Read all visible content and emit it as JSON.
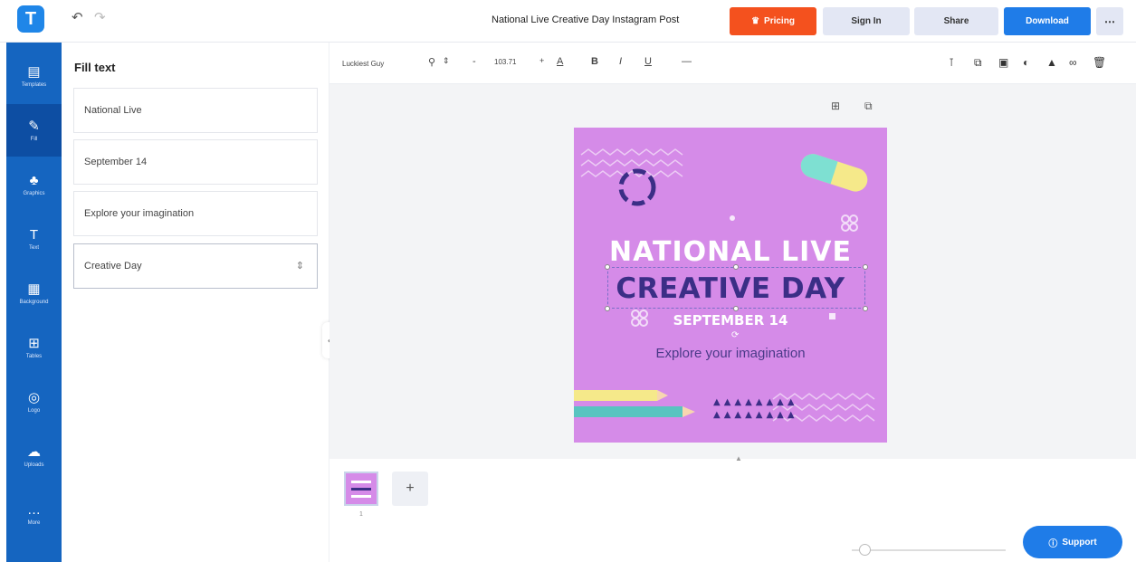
{
  "header": {
    "logo": "T",
    "doc_title": "National Live Creative Day Instagram Post",
    "pricing_label": "Pricing",
    "signin_label": "Sign In",
    "share_label": "Share",
    "download_label": "Download",
    "more_label": "⋯"
  },
  "sidebar": {
    "items": [
      {
        "label": "Templates",
        "icon": "template-icon",
        "glyph": "▤"
      },
      {
        "label": "Fill",
        "icon": "pen-icon",
        "glyph": "✎"
      },
      {
        "label": "Graphics",
        "icon": "shapes-icon",
        "glyph": "♣"
      },
      {
        "label": "Text",
        "icon": "text-icon",
        "glyph": "T"
      },
      {
        "label": "Background",
        "icon": "background-icon",
        "glyph": "▦"
      },
      {
        "label": "Tables",
        "icon": "table-icon",
        "glyph": "⊞"
      },
      {
        "label": "Logo",
        "icon": "logo-icon",
        "glyph": "◎"
      },
      {
        "label": "Uploads",
        "icon": "upload-icon",
        "glyph": "☁"
      },
      {
        "label": "More",
        "icon": "more-icon",
        "glyph": "…"
      }
    ]
  },
  "panel": {
    "title": "Fill text",
    "fields": [
      "National Live",
      "September 14",
      "Explore your imagination",
      "Creative Day"
    ]
  },
  "toolbar": {
    "font_name": "Luckiest Guy",
    "font_size": "103.71"
  },
  "canvas": {
    "line1": "NATIONAL LIVE",
    "line2": "CREATIVE DAY",
    "line3": "SEPTEMBER 14",
    "line4": "Explore your imagination"
  },
  "pages": {
    "thumb_number": "1",
    "add_label": "+"
  },
  "support": {
    "label": "Support"
  },
  "colors": {
    "brand_blue": "#1f7ce8",
    "sidebar_blue": "#1565c0",
    "pricing_orange": "#f4511e",
    "canvas_pink": "#d58be8",
    "title_purple": "#3b2e86"
  }
}
